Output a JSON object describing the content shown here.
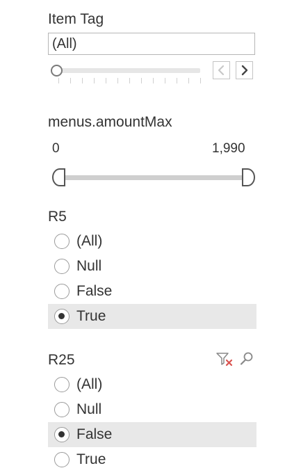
{
  "item_tag": {
    "title": "Item Tag",
    "selected_value": "(All)",
    "slider_value": 0,
    "prev_icon": "chevron-left-icon",
    "next_icon": "chevron-right-icon"
  },
  "amount_max": {
    "title": "menus.amountMax",
    "min_label": "0",
    "max_label": "1,990",
    "range_low": 0,
    "range_high": 1990
  },
  "r5": {
    "title": "R5",
    "options": [
      {
        "label": "(All)",
        "selected": false
      },
      {
        "label": "Null",
        "selected": false
      },
      {
        "label": "False",
        "selected": false
      },
      {
        "label": "True",
        "selected": true
      }
    ]
  },
  "r25": {
    "title": "R25",
    "clear_filter_icon": "clear-filter-icon",
    "search_icon": "search-icon",
    "options": [
      {
        "label": "(All)",
        "selected": false
      },
      {
        "label": "Null",
        "selected": false
      },
      {
        "label": "False",
        "selected": true
      },
      {
        "label": "True",
        "selected": false
      }
    ]
  },
  "colors": {
    "text": "#333333",
    "selected_row": "#e8e8e8",
    "clear_x": "#d9534f"
  }
}
